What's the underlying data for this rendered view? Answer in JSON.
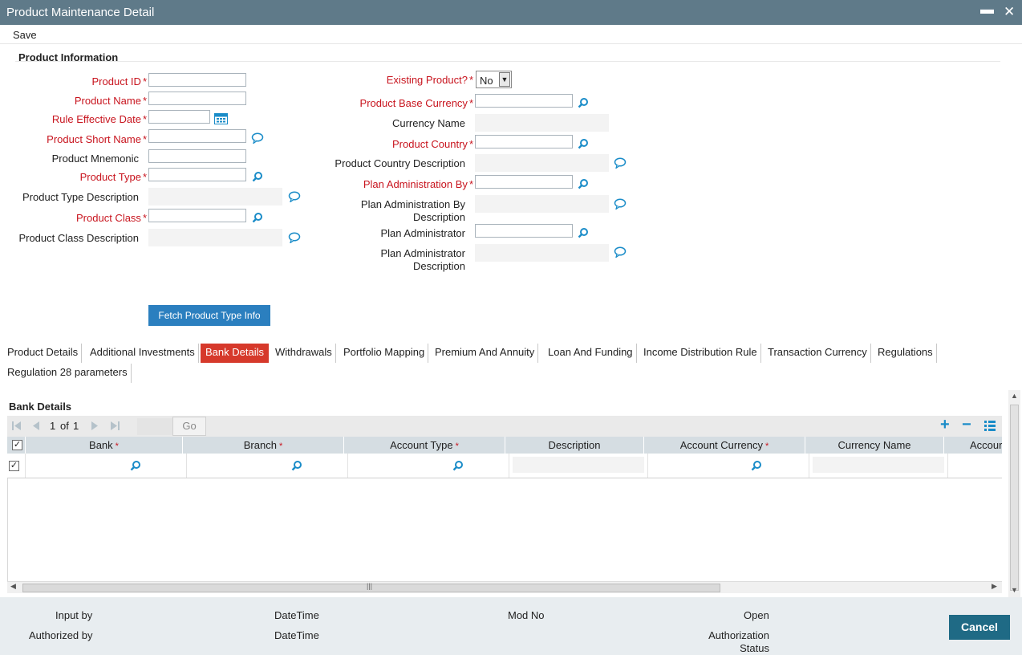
{
  "window": {
    "title": "Product Maintenance Detail",
    "minimize_glyph": "▬",
    "close_glyph": "✕"
  },
  "menu": {
    "save_label": "Save"
  },
  "product_info": {
    "section_title": "Product Information",
    "left_fields": [
      {
        "label": "Product ID",
        "required": true,
        "value": ""
      },
      {
        "label": "Product Name",
        "required": true,
        "value": ""
      },
      {
        "label": "Rule Effective Date",
        "required": true,
        "value": ""
      },
      {
        "label": "Product Short Name",
        "required": true,
        "value": ""
      },
      {
        "label": "Product Mnemonic",
        "required": false,
        "value": ""
      },
      {
        "label": "Product Type",
        "required": true,
        "value": ""
      },
      {
        "label": "Product Type Description",
        "required": false,
        "value": ""
      },
      {
        "label": "Product Class",
        "required": true,
        "value": ""
      },
      {
        "label": "Product Class Description",
        "required": false,
        "value": ""
      }
    ],
    "right_fields": [
      {
        "label": "Existing Product?",
        "required": true,
        "value": "No"
      },
      {
        "label": "Product Base Currency",
        "required": true,
        "value": ""
      },
      {
        "label": "Currency Name",
        "required": false,
        "value": ""
      },
      {
        "label": "Product Country",
        "required": true,
        "value": ""
      },
      {
        "label": "Product Country Description",
        "required": false,
        "value": ""
      },
      {
        "label": "Plan Administration By",
        "required": true,
        "value": ""
      },
      {
        "label": "Plan Administration By",
        "label2": "Description",
        "required": false,
        "value": ""
      },
      {
        "label": "Plan Administrator",
        "required": false,
        "value": ""
      },
      {
        "label": "Plan Administrator",
        "label2": "Description",
        "required": false,
        "value": ""
      }
    ],
    "required_mark": "*",
    "fetch_button": "Fetch Product Type Info"
  },
  "tabs": [
    {
      "label": "Product Details",
      "active": false
    },
    {
      "label": "Additional Investments",
      "active": false
    },
    {
      "label": "Bank Details",
      "active": true
    },
    {
      "label": "Withdrawals",
      "active": false
    },
    {
      "label": "Portfolio Mapping",
      "active": false
    },
    {
      "label": "Premium And Annuity",
      "active": false
    },
    {
      "label": "Loan And Funding",
      "active": false
    },
    {
      "label": "Income Distribution Rule",
      "active": false
    },
    {
      "label": "Transaction Currency",
      "active": false
    },
    {
      "label": "Regulations",
      "active": false
    },
    {
      "label": "Regulation 28 parameters",
      "active": false
    }
  ],
  "bank_details": {
    "title": "Bank Details",
    "pager": {
      "page": "1",
      "of_label": "of",
      "total": "1",
      "go_label": "Go"
    },
    "columns": [
      {
        "label": "Bank",
        "required": true
      },
      {
        "label": "Branch",
        "required": true
      },
      {
        "label": "Account Type",
        "required": true
      },
      {
        "label": "Description",
        "required": false
      },
      {
        "label": "Account Currency",
        "required": true
      },
      {
        "label": "Currency Name",
        "required": false
      },
      {
        "label": "Accour",
        "required": false
      }
    ],
    "required_mark": "*",
    "add_glyph": "+",
    "remove_glyph": "−"
  },
  "footer": {
    "input_by": "Input by",
    "authorized_by": "Authorized by",
    "datetime1": "DateTime",
    "datetime2": "DateTime",
    "mod_no": "Mod No",
    "open": "Open",
    "auth_status_1": "Authorization",
    "auth_status_2": "Status",
    "cancel_label": "Cancel"
  },
  "colors": {
    "titlebar": "#5f7a89",
    "required": "#c8141e",
    "active_tab": "#d6392b",
    "fetch_button": "#2b7fbf",
    "cancel_button": "#1f6a85",
    "icon_blue": "#1a8cc8"
  }
}
